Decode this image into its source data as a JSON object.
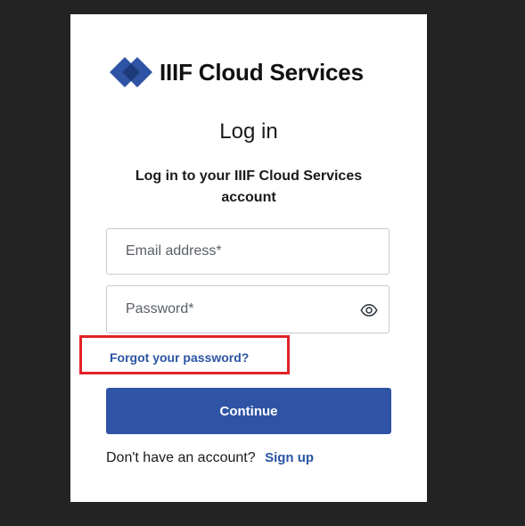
{
  "brand": {
    "name": "IIIF Cloud Services",
    "logo_icon": "diamond-logo-icon",
    "logo_colors": [
      "#3054a5",
      "#1e3a7a"
    ]
  },
  "login": {
    "title": "Log in",
    "subtitle": "Log in to your IIIF Cloud Services account",
    "email_placeholder": "Email address*",
    "email_value": "",
    "password_placeholder": "Password*",
    "password_value": "",
    "show_password_icon": "eye-icon",
    "forgot_password_label": "Forgot your password?",
    "continue_label": "Continue",
    "signup_prompt": "Don't have an account?",
    "signup_label": "Sign up"
  },
  "colors": {
    "accent": "#3054a5",
    "link": "#2b55a3",
    "highlight_border": "#e32229",
    "background": "#232323"
  }
}
